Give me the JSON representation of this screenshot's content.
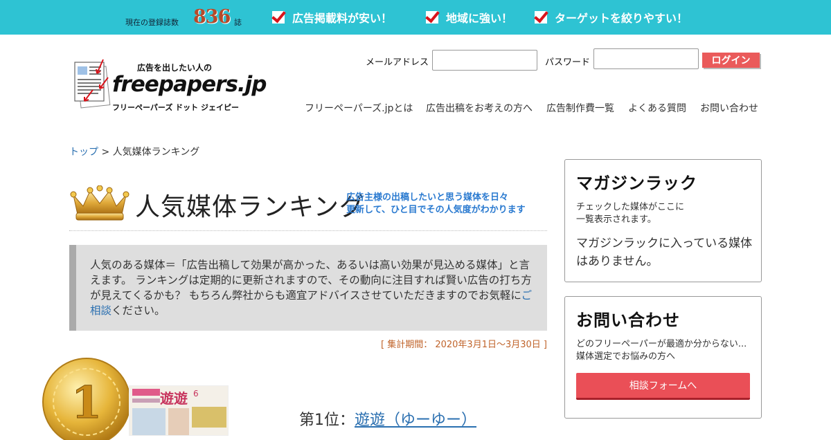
{
  "topbar": {
    "count_label": "現在の登録誌数",
    "count_value": "836",
    "count_unit": "誌",
    "features": [
      "広告掲載料が安い！",
      "地域に強い！",
      "ターゲットを絞りやすい！"
    ],
    "check_color": "#d8141b",
    "bg_color": "#2ec3d3"
  },
  "logo": {
    "tagline": "広告を出したい人の",
    "wordmark": "freepapers.jp",
    "kana": "フリーペーパーズ ドット ジェイピー"
  },
  "login": {
    "email_label": "メールアドレス",
    "email_value": "",
    "password_label": "パスワード",
    "password_value": "",
    "button_label": "ログイン"
  },
  "nav": [
    "フリーペーパーズ.jpとは",
    "広告出稿をお考えの方へ",
    "広告制作費一覧",
    "よくある質問",
    "お問い合わせ"
  ],
  "breadcrumb": {
    "home": "トップ",
    "separator": ">",
    "current": "人気媒体ランキング"
  },
  "title": {
    "main": "人気媒体ランキング",
    "sub_line1": "広告主様の出稿したいと思う媒体を日々",
    "sub_line2": "更新して、ひと目でその人気度がわかります"
  },
  "intro": {
    "text_before_link": "人気のある媒体＝「広告出稿して効果が高かった、あるいは高い効果が見込める媒体」と言えます。 ランキングは定期的に更新されますので、その動向に注目すれば賢い広告の打ち方が見えてくるかも？ もちろん弊社からも適宜アドバイスさせていただきますのでお気軽に",
    "link": "ご相談",
    "text_after_link": "ください。"
  },
  "period": "[ 集計期間： 2020年3月1日～3月30日 ]",
  "rank1": {
    "medal_number": "1",
    "thumb_title": "遊遊",
    "thumb_number": "6",
    "label": "第1位：",
    "name": "遊遊（ゆーゆー）"
  },
  "magazine_rack": {
    "title": "マガジンラック",
    "note_line1": "チェックした媒体がここに",
    "note_line2": "一覧表示されます。",
    "empty_message": "マガジンラックに入っている媒体はありません。"
  },
  "contact": {
    "title": "お問い合わせ",
    "note_line1": "どのフリーペーパーが最適か分からない...",
    "note_line2": "媒体選定でお悩みの方へ",
    "button_label": "相談フォームへ",
    "button_color": "#ea4f57"
  }
}
